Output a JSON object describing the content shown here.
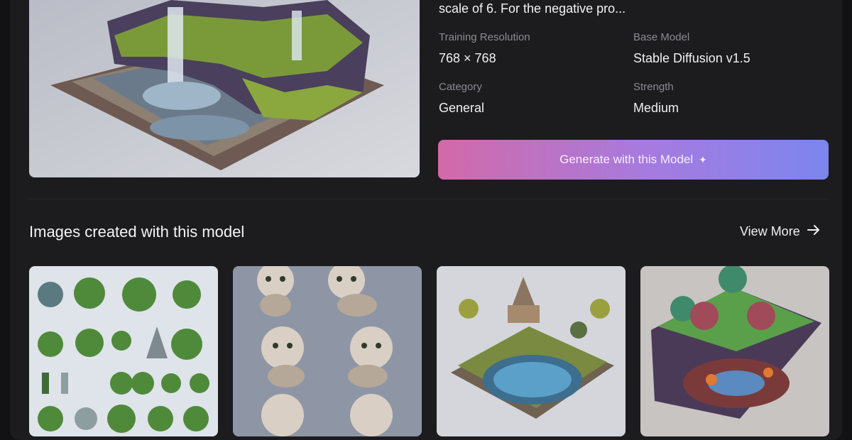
{
  "model": {
    "description_snippet": "scale of 6. For the negative pro...",
    "hero_image": "isometric-waterfall-cliff",
    "details": [
      {
        "label": "Training Resolution",
        "value": "768 × 768"
      },
      {
        "label": "Base Model",
        "value": "Stable Diffusion v1.5"
      },
      {
        "label": "Category",
        "value": "General"
      },
      {
        "label": "Strength",
        "value": "Medium"
      }
    ],
    "generate_button": {
      "label": "Generate with this Model",
      "icon": "sparkle-icon"
    }
  },
  "gallery": {
    "title": "Images created with this model",
    "view_more_label": "View More",
    "view_more_icon": "arrow-right-icon",
    "images": [
      {
        "name": "pixel-trees-sprite-sheet"
      },
      {
        "name": "cute-kittens-sprite-sheet"
      },
      {
        "name": "isometric-temple-island-pond"
      },
      {
        "name": "isometric-lava-cave-castle"
      }
    ]
  },
  "colors": {
    "background": "#121214",
    "panel": "#1c1c1f",
    "label_gray": "#8a8a92",
    "button_gradient_start": "#d26aa8",
    "button_gradient_end": "#7b86ee"
  }
}
